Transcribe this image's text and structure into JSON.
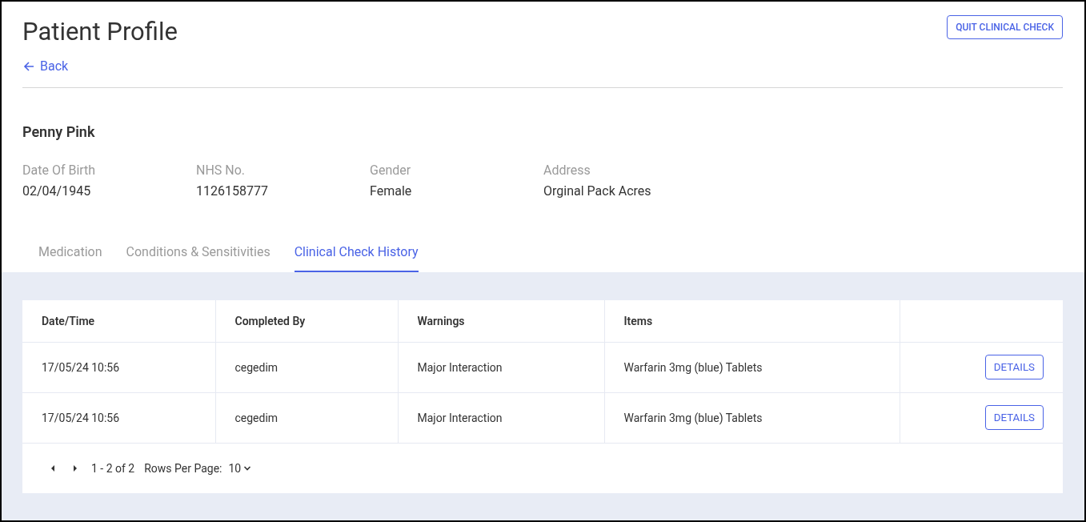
{
  "header": {
    "title": "Patient Profile",
    "back_link": "Back",
    "quit_button": "QUIT CLINICAL CHECK"
  },
  "patient": {
    "name": "Penny Pink",
    "fields": [
      {
        "label": "Date Of Birth",
        "value": "02/04/1945"
      },
      {
        "label": "NHS No.",
        "value": "1126158777"
      },
      {
        "label": "Gender",
        "value": "Female"
      },
      {
        "label": "Address",
        "value": "Orginal Pack Acres"
      }
    ]
  },
  "tabs": [
    {
      "label": "Medication",
      "selected": false
    },
    {
      "label": "Conditions & Sensitivities",
      "selected": false
    },
    {
      "label": "Clinical Check History",
      "selected": true
    }
  ],
  "table": {
    "columns": [
      "Date/Time",
      "Completed By",
      "Warnings",
      "Items"
    ],
    "rows": [
      {
        "cells": [
          "17/05/24 10:56",
          "cegedim",
          "Major Interaction",
          "Warfarin 3mg (blue) Tablets"
        ],
        "action": "DETAILS"
      },
      {
        "cells": [
          "17/05/24 10:56",
          "cegedim",
          "Major Interaction",
          "Warfarin 3mg (blue) Tablets"
        ],
        "action": "DETAILS"
      }
    ]
  },
  "pagination": {
    "range": "1 - 2 of 2",
    "rows_per_page_label": "Rows Per Page:",
    "rows_per_page": "10"
  }
}
